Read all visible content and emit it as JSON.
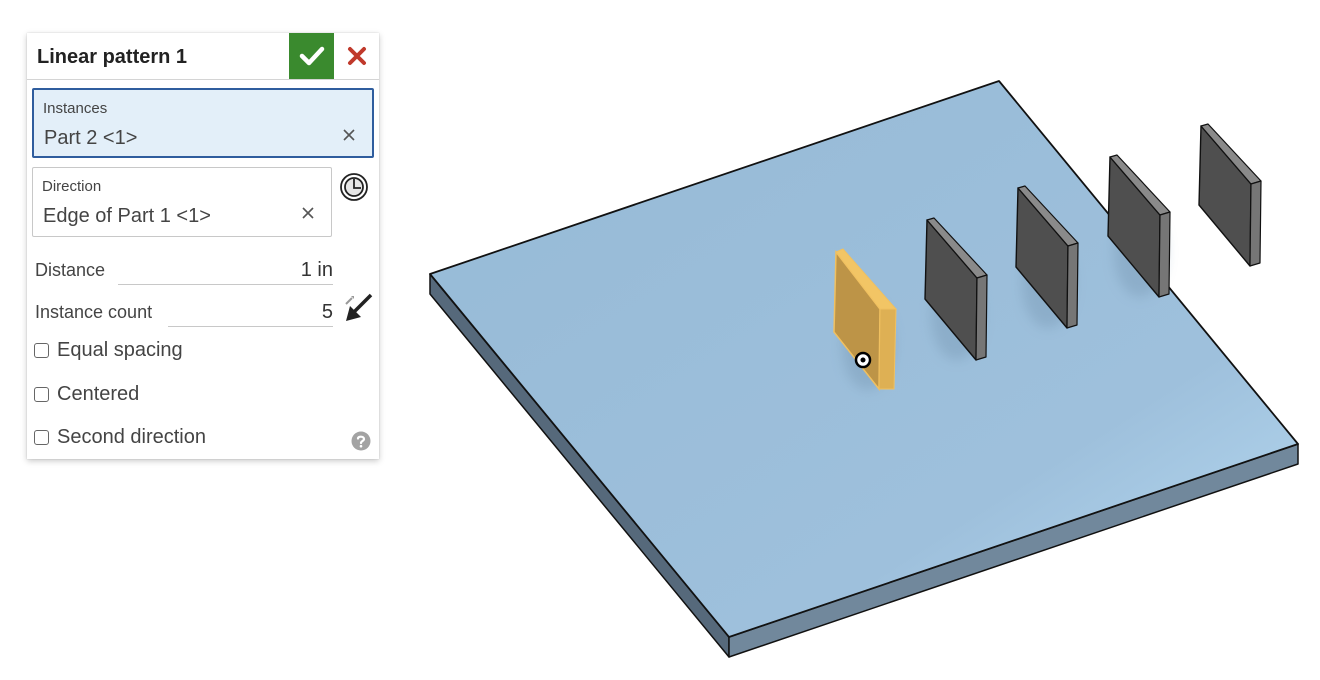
{
  "dialog": {
    "title": "Linear pattern 1",
    "accept_icon": "checkmark-icon",
    "cancel_icon": "close-x-icon",
    "colors": {
      "accept": "#3a8a2e",
      "cancel": "#c0392b",
      "active_field_bg": "#e3eff9",
      "active_field_border": "#2f5d9e"
    },
    "instances": {
      "label": "Instances",
      "value": "Part 2 <1>",
      "clear_icon": "clear-x-icon"
    },
    "direction": {
      "label": "Direction",
      "value": "Edge of Part 1 <1>",
      "clear_icon": "clear-x-icon",
      "side_icon": "direction-clock-icon"
    },
    "distance": {
      "label": "Distance",
      "value": "1 in"
    },
    "instance_count": {
      "label": "Instance count",
      "value": "5",
      "side_icon": "flip-direction-arrow-icon"
    },
    "options": [
      {
        "label": "Equal spacing",
        "checked": false
      },
      {
        "label": "Centered",
        "checked": false
      },
      {
        "label": "Second direction",
        "checked": false
      }
    ],
    "help_icon": "help-question-icon"
  },
  "viewport": {
    "colors": {
      "plate_top": "#9bbdd8",
      "plate_side": "#5a6e80",
      "selected_part": "#c49a48",
      "pattern_part": "#4f4f4f"
    },
    "objects": [
      {
        "name": "Part 1",
        "type": "base-plate"
      },
      {
        "name": "Part 2",
        "type": "seed-instance",
        "selected": true
      },
      {
        "name": "Pattern instance 2",
        "type": "pattern-instance"
      },
      {
        "name": "Pattern instance 3",
        "type": "pattern-instance"
      },
      {
        "name": "Pattern instance 4",
        "type": "pattern-instance"
      },
      {
        "name": "Pattern instance 5",
        "type": "pattern-instance"
      }
    ]
  }
}
